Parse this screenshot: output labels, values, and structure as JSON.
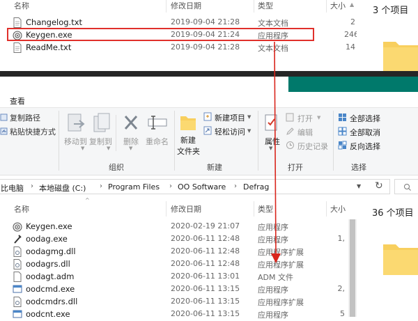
{
  "top_window": {
    "columns": {
      "name": "名称",
      "date": "修改日期",
      "type": "类型",
      "size": "大小"
    },
    "files": [
      {
        "name": "Changelog.txt",
        "date": "2019-09-04 21:28",
        "type": "文本文档",
        "size": "2",
        "icon": "text-file-icon"
      },
      {
        "name": "Keygen.exe",
        "date": "2019-09-04 21:24",
        "type": "应用程序",
        "size": "246",
        "icon": "exe-app-icon"
      },
      {
        "name": "ReadMe.txt",
        "date": "2019-09-04 21:28",
        "type": "文本文档",
        "size": "14",
        "icon": "text-file-icon"
      }
    ],
    "item_count": "3 个项目"
  },
  "ribbon": {
    "tab": "查看",
    "clipboard": {
      "copy_path": "复制路径",
      "paste_shortcut": "粘贴快捷方式"
    },
    "organize": {
      "move_to": "移动到",
      "copy_to": "复制到",
      "delete": "删除",
      "rename": "重命名",
      "group": "组织"
    },
    "new": {
      "new_item": "新建项目",
      "easy_access": "轻松访问",
      "new_folder_line1": "新建",
      "new_folder_line2": "文件夹",
      "group": "新建"
    },
    "open": {
      "properties": "属性",
      "open": "打开",
      "edit": "编辑",
      "history": "历史记录",
      "group": "打开"
    },
    "select": {
      "select_all": "全部选择",
      "select_none": "全部取消",
      "invert": "反向选择",
      "group": "选择"
    }
  },
  "address": {
    "crumbs": [
      "比电脑",
      "本地磁盘 (C:)",
      "Program Files",
      "OO Software",
      "Defrag"
    ]
  },
  "bottom_window": {
    "columns": {
      "name": "名称",
      "date": "修改日期",
      "type": "类型",
      "size": "大小"
    },
    "files": [
      {
        "name": "Keygen.exe",
        "date": "2020-02-19 21:07",
        "type": "应用程序",
        "size": "",
        "icon": "exe-app-icon"
      },
      {
        "name": "oodag.exe",
        "date": "2020-06-11 12:48",
        "type": "应用程序",
        "size": "1,",
        "icon": "exe-tool-icon"
      },
      {
        "name": "oodagmg.dll",
        "date": "2020-06-11 12:48",
        "type": "应用程序扩展",
        "size": "",
        "icon": "dll-file-icon"
      },
      {
        "name": "oodagrs.dll",
        "date": "2020-06-11 12:48",
        "type": "应用程序扩展",
        "size": "",
        "icon": "dll-file-icon"
      },
      {
        "name": "oodagt.adm",
        "date": "2020-06-11 13:01",
        "type": "ADM 文件",
        "size": "",
        "icon": "blank-file-icon"
      },
      {
        "name": "oodcmd.exe",
        "date": "2020-06-11 13:15",
        "type": "应用程序",
        "size": "2,",
        "icon": "exe-window-icon"
      },
      {
        "name": "oodcmdrs.dll",
        "date": "2020-06-11 13:15",
        "type": "应用程序扩展",
        "size": "",
        "icon": "dll-file-icon"
      },
      {
        "name": "oodcnt.exe",
        "date": "2020-06-11 13:15",
        "type": "应用程序",
        "size": "5",
        "icon": "exe-window-icon"
      }
    ],
    "item_count": "36 个项目"
  },
  "colors": {
    "highlight": "#e0302b",
    "arrow": "#d9251c",
    "teal_band": "#00796b",
    "folder": "#f8cf5e"
  }
}
